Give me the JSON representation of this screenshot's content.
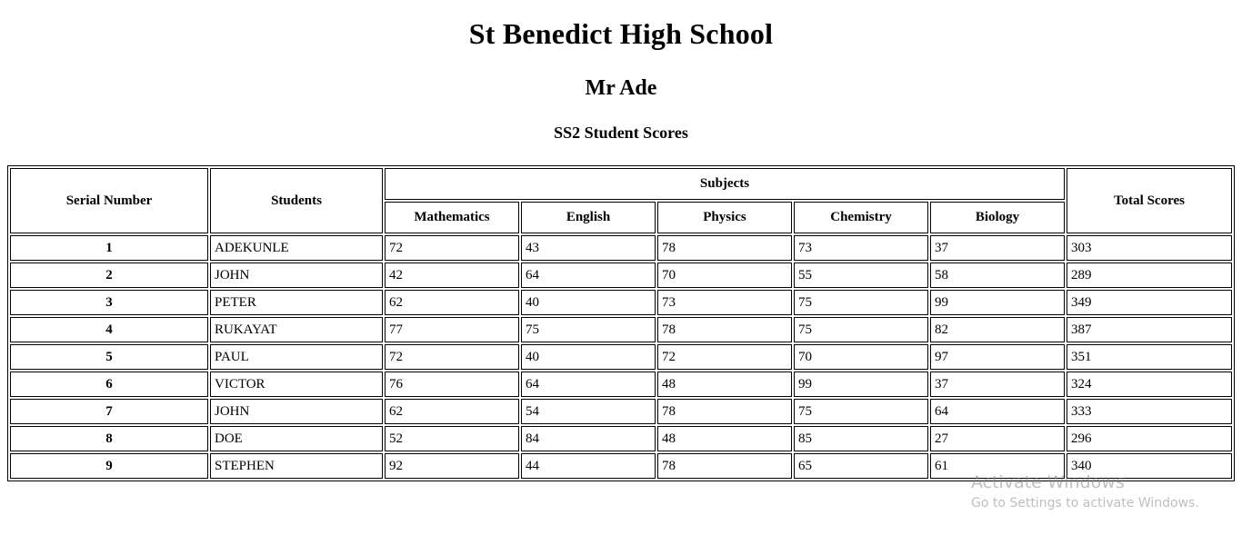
{
  "header": {
    "school_title": "St Benedict High School",
    "teacher_name": "Mr Ade",
    "class_subtitle": "SS2 Student Scores"
  },
  "table": {
    "columns": {
      "serial": "Serial Number",
      "students": "Students",
      "subjects_group": "Subjects",
      "total": "Total Scores"
    },
    "subjects": [
      "Mathematics",
      "English",
      "Physics",
      "Chemistry",
      "Biology"
    ],
    "rows": [
      {
        "serial": "1",
        "student": "ADEKUNLE",
        "mathematics": "72",
        "english": "43",
        "physics": "78",
        "chemistry": "73",
        "biology": "37",
        "total": "303"
      },
      {
        "serial": "2",
        "student": "JOHN",
        "mathematics": "42",
        "english": "64",
        "physics": "70",
        "chemistry": "55",
        "biology": "58",
        "total": "289"
      },
      {
        "serial": "3",
        "student": "PETER",
        "mathematics": "62",
        "english": "40",
        "physics": "73",
        "chemistry": "75",
        "biology": "99",
        "total": "349"
      },
      {
        "serial": "4",
        "student": "RUKAYAT",
        "mathematics": "77",
        "english": "75",
        "physics": "78",
        "chemistry": "75",
        "biology": "82",
        "total": "387"
      },
      {
        "serial": "5",
        "student": "PAUL",
        "mathematics": "72",
        "english": "40",
        "physics": "72",
        "chemistry": "70",
        "biology": "97",
        "total": "351"
      },
      {
        "serial": "6",
        "student": "VICTOR",
        "mathematics": "76",
        "english": "64",
        "physics": "48",
        "chemistry": "99",
        "biology": "37",
        "total": "324"
      },
      {
        "serial": "7",
        "student": "JOHN",
        "mathematics": "62",
        "english": "54",
        "physics": "78",
        "chemistry": "75",
        "biology": "64",
        "total": "333"
      },
      {
        "serial": "8",
        "student": "DOE",
        "mathematics": "52",
        "english": "84",
        "physics": "48",
        "chemistry": "85",
        "biology": "27",
        "total": "296"
      },
      {
        "serial": "9",
        "student": "STEPHEN",
        "mathematics": "92",
        "english": "44",
        "physics": "78",
        "chemistry": "65",
        "biology": "61",
        "total": "340"
      }
    ]
  },
  "watermark": {
    "title": "Activate Windows",
    "subtitle": "Go to Settings to activate Windows."
  },
  "colors": {
    "text": "#000000",
    "border": "#000000",
    "background": "#ffffff",
    "watermark": "#8a8a8a"
  }
}
